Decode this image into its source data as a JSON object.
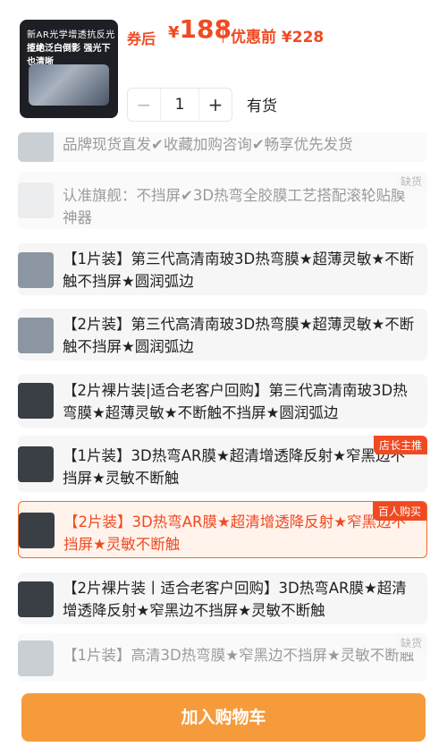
{
  "product": {
    "image_text_line1": "新AR光学增透抗反光技术",
    "image_text_line2": "拒绝泛白倒影 强光下也清晰",
    "price_after_label": "券后",
    "price_after_currency": "¥",
    "price_after_value": "188",
    "price_before": "优惠前 ¥228"
  },
  "stepper": {
    "minus": "−",
    "qty": "1",
    "plus": "+"
  },
  "stock_status": "有货",
  "options": [
    {
      "text": "品牌现货直发✔收藏加购咨询✔畅享优先发货",
      "state": "disabled",
      "badge": ""
    },
    {
      "text": "认准旗舰：不挡屏✔3D热弯全胶膜工艺搭配滚轮贴膜神器",
      "state": "disabled",
      "badge": "缺货"
    },
    {
      "text": "【1片装】第三代高清南玻3D热弯膜★超薄灵敏★不断触不挡屏★圆润弧边",
      "state": "normal",
      "badge": ""
    },
    {
      "text": "【2片装】第三代高清南玻3D热弯膜★超薄灵敏★不断触不挡屏★圆润弧边",
      "state": "normal",
      "badge": ""
    },
    {
      "text": "【2片裸片装|适合老客户回购】第三代高清南玻3D热弯膜★超薄灵敏★不断触不挡屏★圆润弧边",
      "state": "normal",
      "badge": ""
    },
    {
      "text": "【1片装】3D热弯AR膜★超清增透降反射★窄黑边不挡屏★灵敏不断触",
      "state": "normal",
      "badge": "店长主推"
    },
    {
      "text": "【2片装】3D热弯AR膜★超清增透降反射★窄黑边不挡屏★灵敏不断触",
      "state": "selected",
      "badge": "百人购买"
    },
    {
      "text": "【2片裸片装丨适合老客户回购】3D热弯AR膜★超清增透降反射★窄黑边不挡屏★灵敏不断触",
      "state": "normal",
      "badge": ""
    },
    {
      "text": "【1片装】高清3D热弯膜★窄黑边不挡屏★灵敏不断触",
      "state": "disabled",
      "badge": "缺货"
    }
  ],
  "add_to_cart": "加入购物车"
}
